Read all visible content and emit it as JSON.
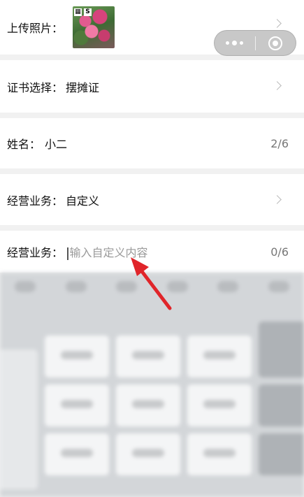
{
  "form": {
    "photo": {
      "label": "上传照片："
    },
    "certificate": {
      "label": "证书选择：",
      "value": "摆摊证"
    },
    "name": {
      "label": "姓名：",
      "value": "小二",
      "counter": "2/6"
    },
    "business_select": {
      "label": "经营业务：",
      "value": "自定义"
    },
    "business_custom": {
      "label": "经营业务：",
      "placeholder": "输入自定义内容",
      "counter": "0/6"
    }
  },
  "capsule": {
    "menu_icon": "more-dots-icon",
    "close_icon": "target-close-icon"
  },
  "colors": {
    "arrow": "#e0252a",
    "placeholder": "#9a9a9a",
    "background": "#f1f1f1"
  }
}
